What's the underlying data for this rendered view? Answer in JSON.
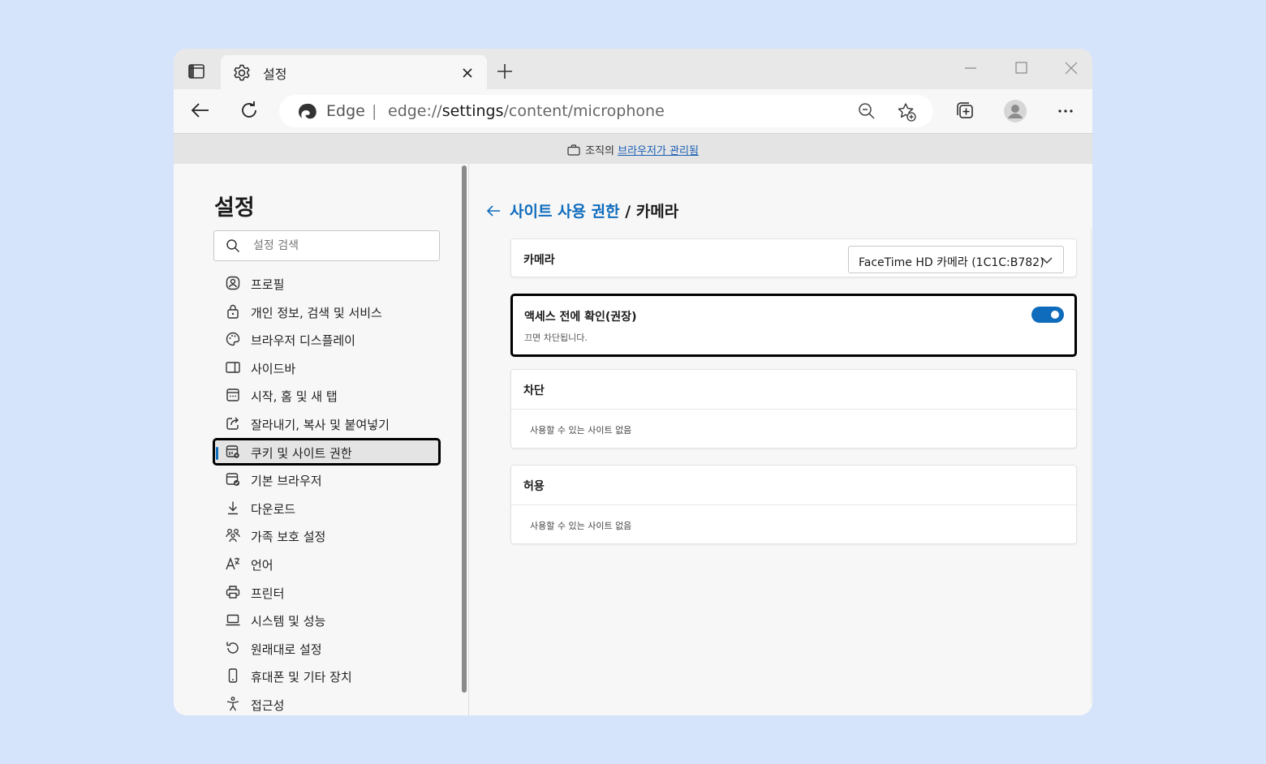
{
  "browser": {
    "tab_title": "설정",
    "omnibox_brand": "Edge",
    "omnibox_separator": "|",
    "url_prefix": "edge://",
    "url_host": "settings",
    "url_path": "/content/microphone"
  },
  "managed_bar": {
    "prefix": "조직의",
    "link": "브라우저가 관리됨"
  },
  "sidebar": {
    "title": "설정",
    "search_placeholder": "설정 검색",
    "items": [
      {
        "label": "프로필",
        "icon": "profile-icon"
      },
      {
        "label": "개인 정보, 검색 및 서비스",
        "icon": "lock-icon"
      },
      {
        "label": "브라우저 디스플레이",
        "icon": "palette-icon"
      },
      {
        "label": "사이드바",
        "icon": "sidebar-panel-icon"
      },
      {
        "label": "시작, 홈 및 새 탭",
        "icon": "home-tab-icon"
      },
      {
        "label": "잘라내기, 복사 및 붙여넣기",
        "icon": "share-icon"
      },
      {
        "label": "쿠키 및 사이트 권한",
        "icon": "cookie-settings-icon",
        "active": true
      },
      {
        "label": "기본 브라우저",
        "icon": "default-browser-icon"
      },
      {
        "label": "다운로드",
        "icon": "download-icon"
      },
      {
        "label": "가족 보호 설정",
        "icon": "family-icon"
      },
      {
        "label": "언어",
        "icon": "language-icon"
      },
      {
        "label": "프린터",
        "icon": "printer-icon"
      },
      {
        "label": "시스템 및 성능",
        "icon": "laptop-icon"
      },
      {
        "label": "원래대로 설정",
        "icon": "reset-icon"
      },
      {
        "label": "휴대폰 및 기타 장치",
        "icon": "phone-icon"
      },
      {
        "label": "접근성",
        "icon": "accessibility-icon"
      }
    ]
  },
  "main": {
    "breadcrumb_link": "사이트 사용 권한",
    "breadcrumb_separator": " / ",
    "breadcrumb_current": "카메라",
    "camera_label": "카메라",
    "camera_device": "FaceTime HD 카메라 (1C1C:B782)",
    "ask_label": "액세스 전에 확인(권장)",
    "ask_sub": "끄면 차단됩니다.",
    "ask_enabled": true,
    "block_heading": "차단",
    "block_empty": "사용할 수 있는 사이트 없음",
    "allow_heading": "허용",
    "allow_empty": "사용할 수 있는 사이트 없음"
  },
  "colors": {
    "accent": "#0f6cbd",
    "background": "#d6e4fb"
  }
}
